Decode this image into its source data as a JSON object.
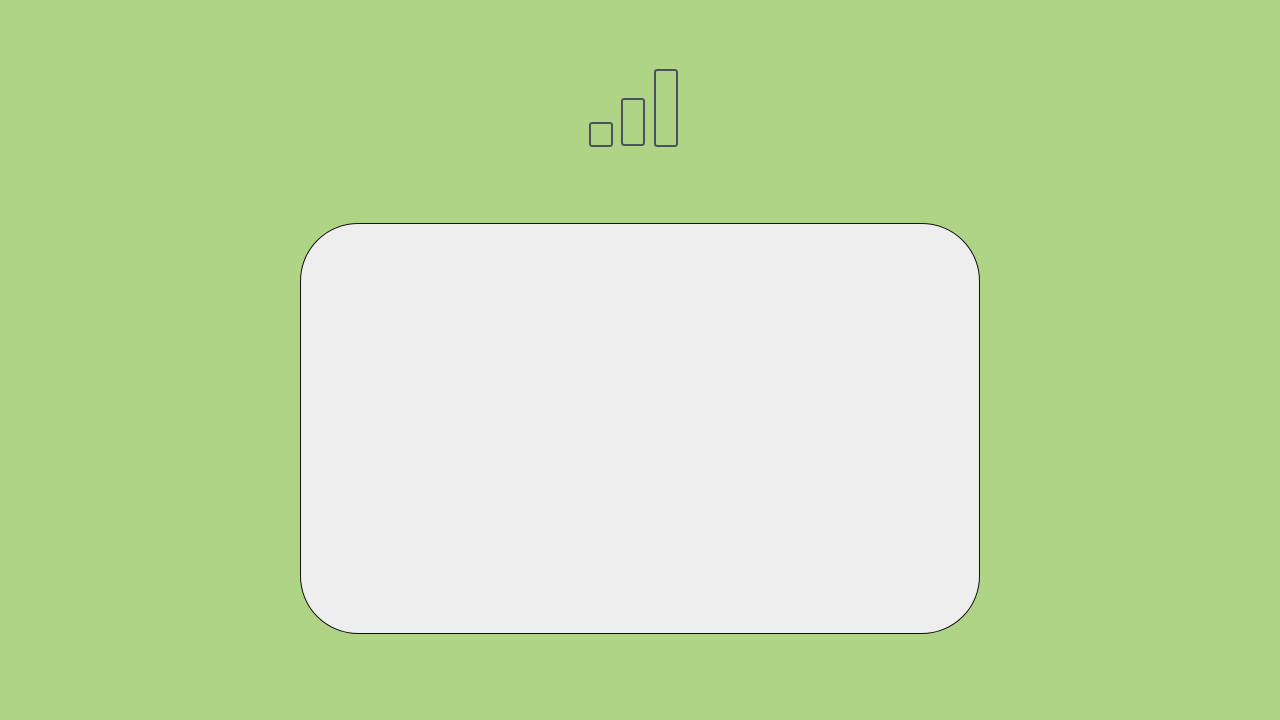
{
  "theme": {
    "background_color": "#b0d486",
    "panel_color": "#eeeeee",
    "panel_border_color": "#111111",
    "icon_stroke_color": "#4a5261"
  },
  "header": {
    "icon": "bar-chart-icon"
  },
  "panel": {
    "content": ""
  }
}
